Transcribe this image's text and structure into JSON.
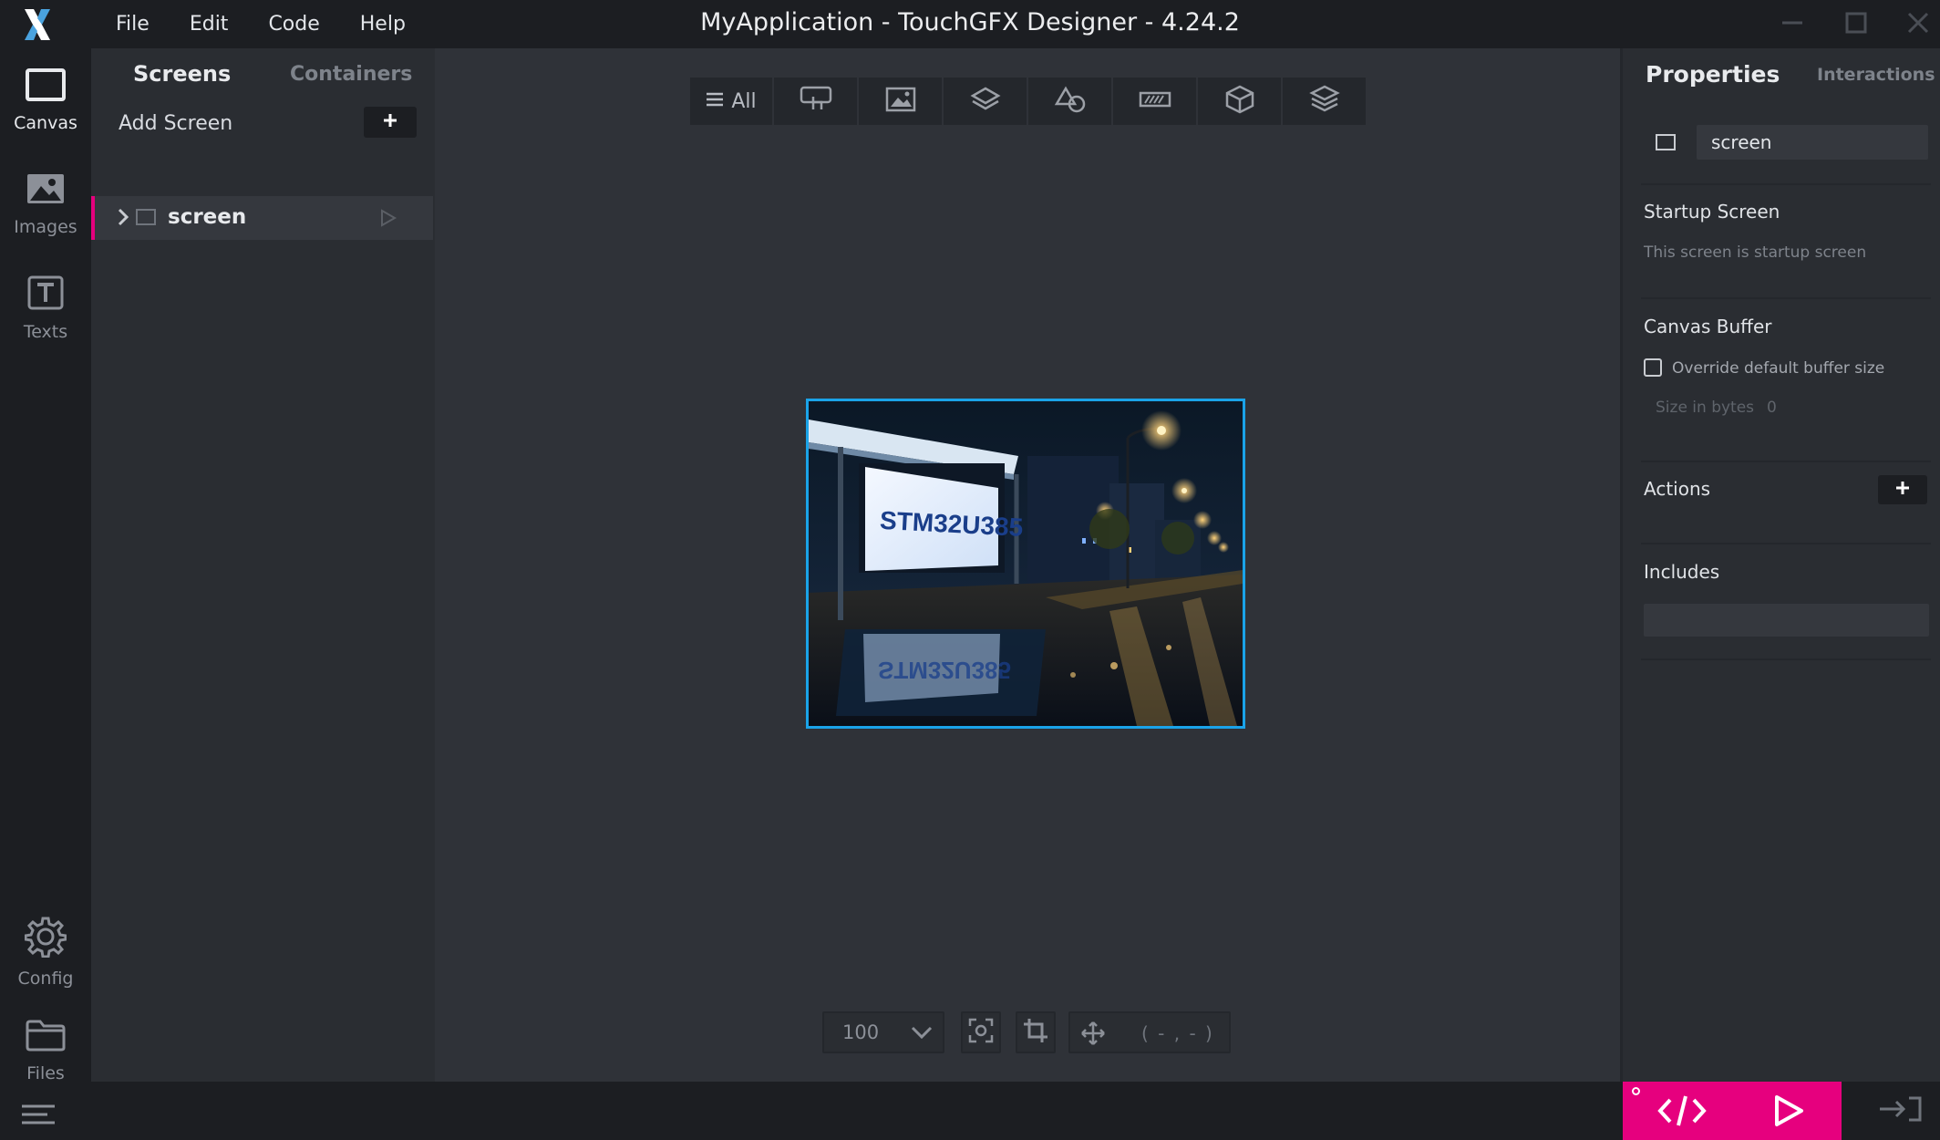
{
  "window": {
    "title": "MyApplication - TouchGFX Designer - 4.24.2"
  },
  "menu": {
    "file": "File",
    "edit": "Edit",
    "code": "Code",
    "help": "Help"
  },
  "nav": {
    "canvas": "Canvas",
    "images": "Images",
    "texts": "Texts",
    "config": "Config",
    "files": "Files"
  },
  "screens_panel": {
    "tab_screens": "Screens",
    "tab_containers": "Containers",
    "add_screen": "Add Screen",
    "items": [
      {
        "label": "screen"
      }
    ]
  },
  "canvas": {
    "filter_all": "All",
    "preview_sign_text": "STM32U385",
    "zoom": "100",
    "coordinates": "( - , - )"
  },
  "properties": {
    "tab_properties": "Properties",
    "tab_interactions": "Interactions",
    "name": "screen",
    "startup_title": "Startup Screen",
    "startup_text": "This screen is startup screen",
    "canvas_buffer_title": "Canvas Buffer",
    "override_label": "Override default buffer size",
    "size_label": "Size in bytes",
    "size_value": "0",
    "override_checked": false,
    "actions_title": "Actions",
    "includes_title": "Includes"
  },
  "colors": {
    "accent": "#e6007e",
    "selection": "#1aa3e8",
    "logo": "#4aa3df"
  }
}
